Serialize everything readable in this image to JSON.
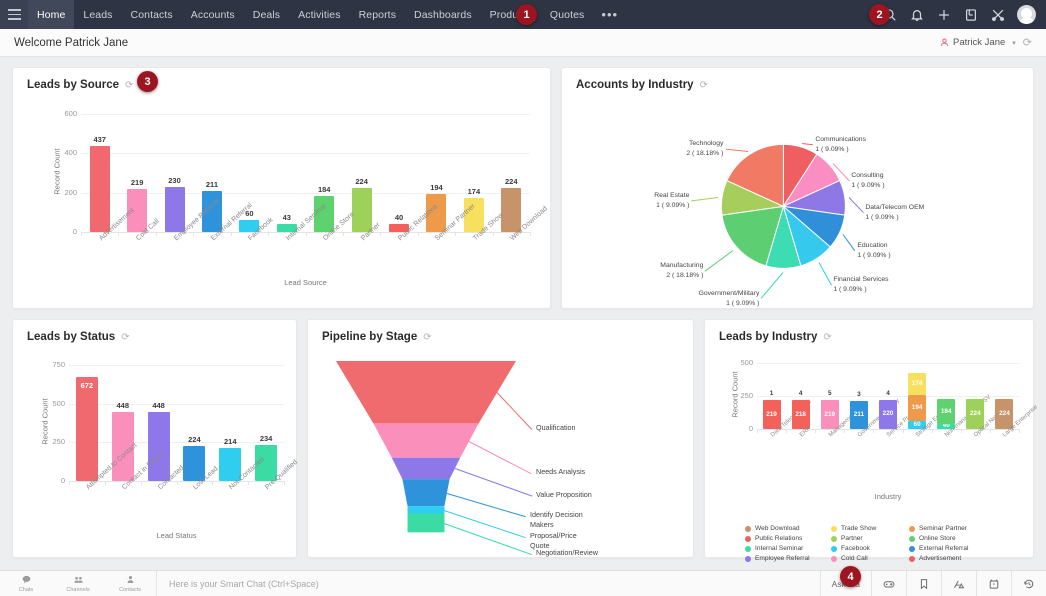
{
  "topnav": {
    "menu_icon": "hamburger-icon",
    "tabs": [
      {
        "label": "Home",
        "active": true
      },
      {
        "label": "Leads",
        "active": false
      },
      {
        "label": "Contacts",
        "active": false
      },
      {
        "label": "Accounts",
        "active": false
      },
      {
        "label": "Deals",
        "active": false
      },
      {
        "label": "Activities",
        "active": false
      },
      {
        "label": "Reports",
        "active": false
      },
      {
        "label": "Dashboards",
        "active": false
      },
      {
        "label": "Products",
        "active": false
      },
      {
        "label": "Quotes",
        "active": false
      }
    ],
    "more_label": "•••",
    "icons": [
      "search-icon",
      "bell-icon",
      "plus-icon",
      "notes-icon",
      "tools-icon",
      "avatar"
    ]
  },
  "markers": {
    "m1": "1",
    "m2": "2",
    "m3": "3",
    "m4": "4"
  },
  "welcome": {
    "title": "Welcome Patrick Jane",
    "user": "Patrick Jane",
    "caret": "▾",
    "refresh": "⟳"
  },
  "cards": {
    "leads_by_source": {
      "title": "Leads by Source",
      "refresh": "⟳"
    },
    "accounts_by_industry": {
      "title": "Accounts by Industry",
      "refresh": "⟳"
    },
    "leads_by_status": {
      "title": "Leads by Status",
      "refresh": "⟳"
    },
    "pipeline_by_stage": {
      "title": "Pipeline by Stage",
      "refresh": "⟳"
    },
    "leads_by_industry": {
      "title": "Leads by Industry",
      "refresh": "⟳"
    }
  },
  "bottombar": {
    "items": [
      {
        "label": "Chats",
        "icon": "chat-icon"
      },
      {
        "label": "Channels",
        "icon": "channels-icon"
      },
      {
        "label": "Contacts",
        "icon": "contacts-icon"
      }
    ],
    "smartchat_placeholder": "Here is your Smart Chat (Ctrl+Space)",
    "ask_zia": "Ask Zia",
    "right_icons": [
      "game-controller-icon",
      "bookmark-icon",
      "analytics-icon",
      "timer-icon",
      "history-icon"
    ]
  },
  "chart_data": [
    {
      "id": "leads_by_source",
      "type": "bar",
      "title": "Leads by Source",
      "xlabel": "Lead Source",
      "ylabel": "Record Count",
      "ylim": [
        0,
        600
      ],
      "yticks": [
        0,
        200,
        400,
        600
      ],
      "grid": true,
      "legend": "none",
      "categories": [
        "Advertisement",
        "Cold Call",
        "Employee Referral",
        "External Referral",
        "Facebook",
        "Internal Seminar",
        "Online Store",
        "Partner",
        "Public Relations",
        "Seminar Partner",
        "Trade Show",
        "Web Download"
      ],
      "values": [
        437,
        219,
        230,
        211,
        60,
        43,
        184,
        224,
        40,
        194,
        174,
        224
      ],
      "colors": [
        "#f0696e",
        "#fa8fbc",
        "#8e77e8",
        "#2f93db",
        "#2fcdf0",
        "#3bdba4",
        "#5ed26e",
        "#9ed159",
        "#f4605a",
        "#ee9a4b",
        "#f8e05f",
        "#c79368"
      ]
    },
    {
      "id": "accounts_by_industry",
      "type": "pie",
      "title": "Accounts by Industry",
      "total": 11,
      "slices": [
        {
          "label": "Communications",
          "value": 1,
          "percent": "9.09%",
          "color": "#ef5f61"
        },
        {
          "label": "Consulting",
          "value": 1,
          "percent": "9.09%",
          "color": "#fa8ec2"
        },
        {
          "label": "Data/Telecom OEM",
          "value": 1,
          "percent": "9.09%",
          "color": "#8e78e6"
        },
        {
          "label": "Education",
          "value": 1,
          "percent": "9.09%",
          "color": "#2f8fd8"
        },
        {
          "label": "Financial Services",
          "value": 1,
          "percent": "9.09%",
          "color": "#35c9ee"
        },
        {
          "label": "Government/Military",
          "value": 1,
          "percent": "9.09%",
          "color": "#3ddcb2"
        },
        {
          "label": "Manufacturing",
          "value": 2,
          "percent": "18.18%",
          "color": "#5ece72"
        },
        {
          "label": "Real Estate",
          "value": 1,
          "percent": "9.09%",
          "color": "#a5ce5d"
        },
        {
          "label": "Technology",
          "value": 2,
          "percent": "18.18%",
          "color": "#f07a63"
        }
      ]
    },
    {
      "id": "leads_by_status",
      "type": "bar",
      "title": "Leads by Status",
      "xlabel": "Lead Status",
      "ylabel": "Record Count",
      "ylim": [
        0,
        750
      ],
      "yticks": [
        0,
        250,
        500,
        750
      ],
      "grid": true,
      "categories": [
        "Attempted to Contact",
        "Contact in Future",
        "Contacted",
        "Lost Lead",
        "Not Contacted",
        "Pre-Qualified"
      ],
      "values": [
        672,
        448,
        448,
        224,
        214,
        234
      ],
      "colors": [
        "#f0696e",
        "#fa8fbc",
        "#8e77e8",
        "#2f93db",
        "#2fcdf0",
        "#3bdba4"
      ]
    },
    {
      "id": "pipeline_by_stage",
      "type": "funnel",
      "title": "Pipeline by Stage",
      "stages": [
        {
          "label": "Qualification",
          "color": "#ef6b6e"
        },
        {
          "label": "Needs Analysis",
          "color": "#fa8fbc"
        },
        {
          "label": "Value Proposition",
          "color": "#8e77e8"
        },
        {
          "label": "Identify Decision Makers",
          "color": "#2f93db"
        },
        {
          "label": "Proposal/Price Quote",
          "color": "#2fcdf0"
        },
        {
          "label": "Negotiation/Review",
          "color": "#3bdba4"
        }
      ]
    },
    {
      "id": "leads_by_industry",
      "type": "bar",
      "stacked": true,
      "title": "Leads by Industry",
      "xlabel": "Industry",
      "ylabel": "Record Count",
      "ylim": [
        0,
        500
      ],
      "yticks": [
        0,
        250,
        500
      ],
      "grid": true,
      "categories": [
        "Data/Telecom OEM",
        "ERP",
        "ManagementISV",
        "Government/Military",
        "Service Provider",
        "Storage Equipment",
        "Non-management ISV",
        "Optical Networking",
        "Large Enterprise"
      ],
      "bars": [
        {
          "segments": [
            {
              "value": 219,
              "color": "#f4605a"
            }
          ],
          "top_label": "1"
        },
        {
          "segments": [
            {
              "value": 218,
              "color": "#f4605a"
            }
          ],
          "top_label": "4"
        },
        {
          "segments": [
            {
              "value": 219,
              "color": "#fa8fbc"
            }
          ],
          "top_label": "5"
        },
        {
          "segments": [
            {
              "value": 211,
              "color": "#2f93db"
            }
          ],
          "top_label": "3"
        },
        {
          "segments": [
            {
              "value": 220,
              "color": "#8e77e8"
            }
          ],
          "top_label": "4"
        },
        {
          "segments": [
            {
              "value": 60,
              "color": "#2fcdf0"
            },
            {
              "value": 194,
              "color": "#ee9a4b"
            },
            {
              "value": 174,
              "color": "#f8e05f"
            }
          ],
          "top_label": ""
        },
        {
          "segments": [
            {
              "value": 40,
              "color": "#3bdba4"
            },
            {
              "value": 184,
              "color": "#5ed26e"
            }
          ],
          "top_label": ""
        },
        {
          "segments": [
            {
              "value": 224,
              "color": "#9ed159"
            }
          ],
          "top_label": ""
        },
        {
          "segments": [
            {
              "value": 224,
              "color": "#c79368"
            }
          ],
          "top_label": ""
        }
      ],
      "legend_position": "bottom",
      "legend": [
        {
          "label": "Web Download",
          "color": "#c79368"
        },
        {
          "label": "Trade Show",
          "color": "#f8e05f"
        },
        {
          "label": "Seminar Partner",
          "color": "#ee9a4b"
        },
        {
          "label": "Public Relations",
          "color": "#f4605a"
        },
        {
          "label": "Partner",
          "color": "#9ed159"
        },
        {
          "label": "Online Store",
          "color": "#5ed26e"
        },
        {
          "label": "Internal Seminar",
          "color": "#3bdba4"
        },
        {
          "label": "Facebook",
          "color": "#2fcdf0"
        },
        {
          "label": "External Referral",
          "color": "#2f93db"
        },
        {
          "label": "Employee Referral",
          "color": "#8e77e8"
        },
        {
          "label": "Cold Call",
          "color": "#fa8fbc"
        },
        {
          "label": "Advertisement",
          "color": "#ef5f61"
        }
      ]
    }
  ]
}
